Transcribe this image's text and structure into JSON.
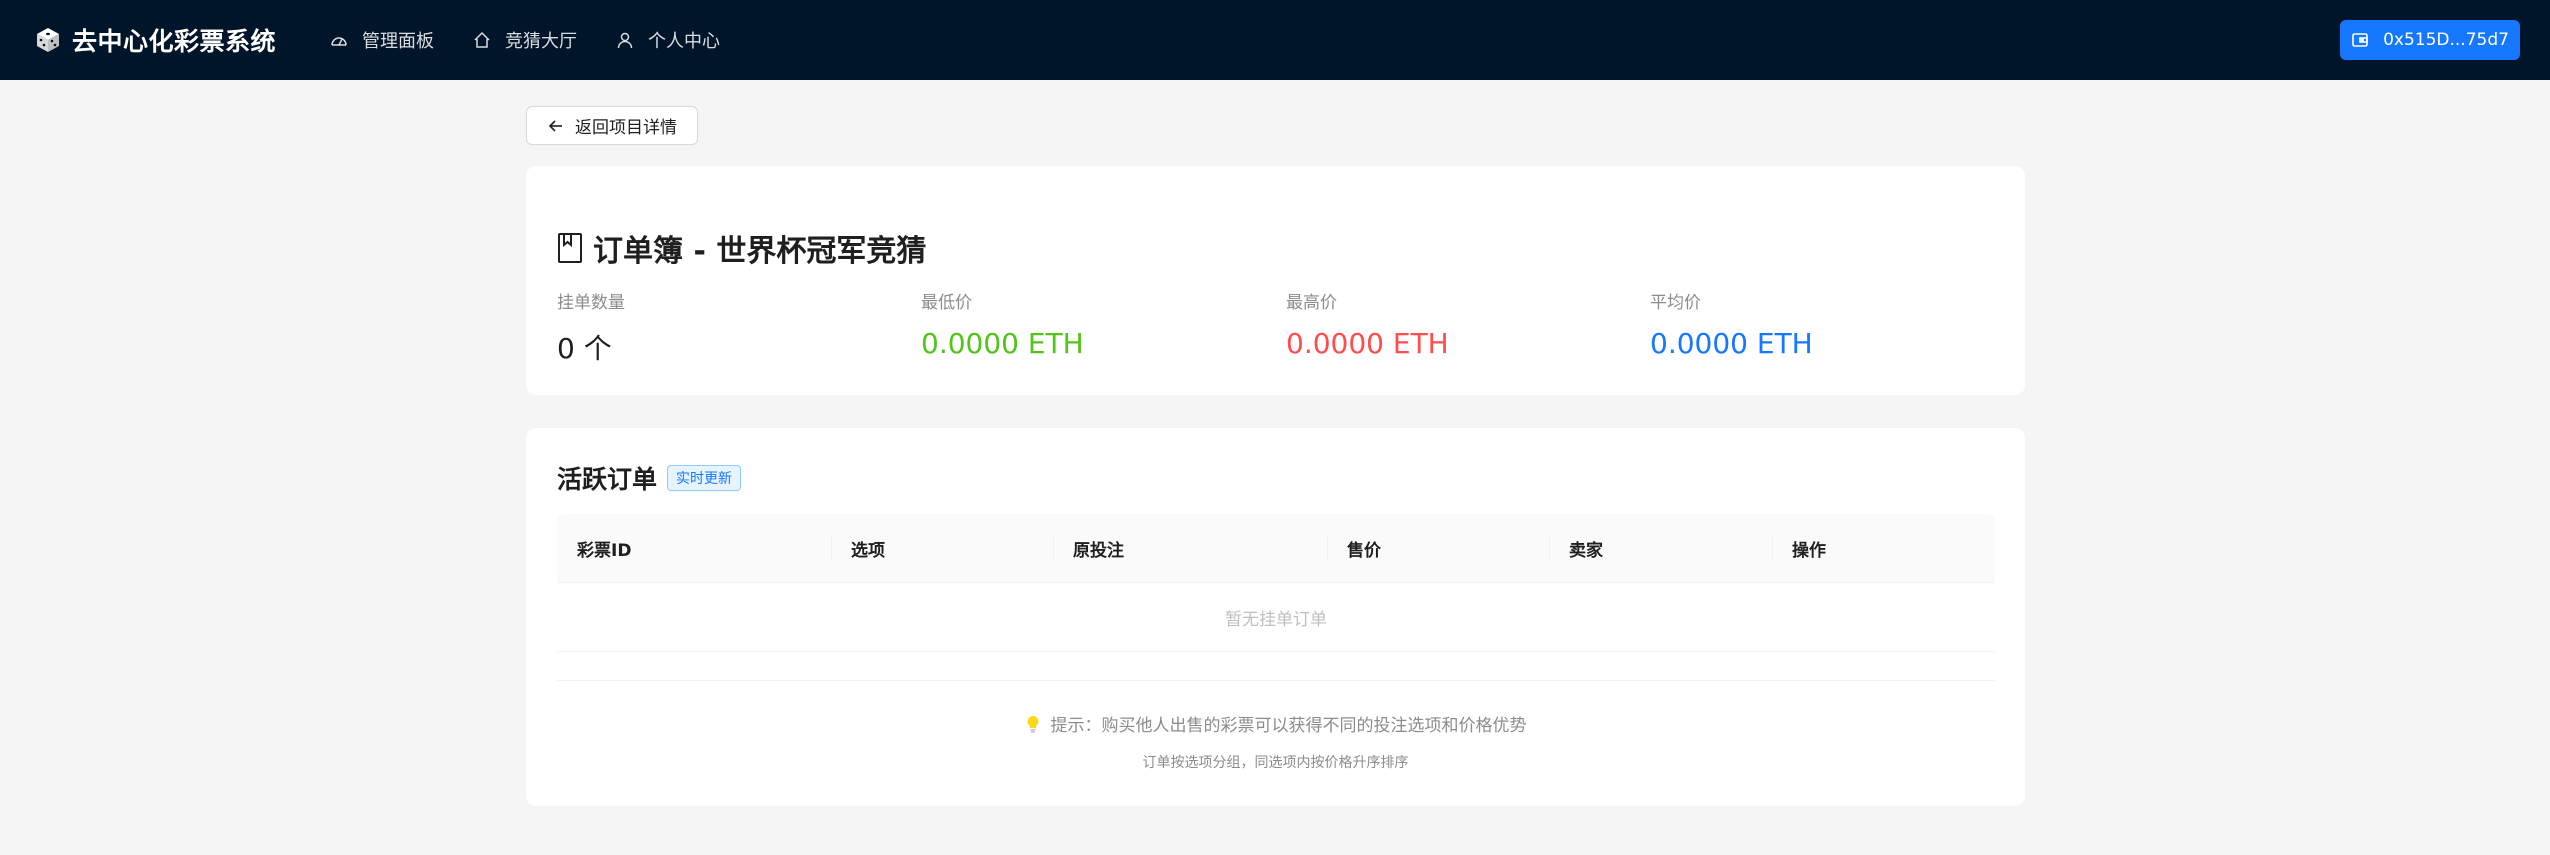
{
  "header": {
    "brand_title": "去中心化彩票系统",
    "nav": [
      {
        "label": "管理面板",
        "icon": "dashboard-icon"
      },
      {
        "label": "竞猜大厅",
        "icon": "home-icon"
      },
      {
        "label": "个人中心",
        "icon": "user-icon"
      }
    ],
    "wallet_label": "0x515D...75d7",
    "wallet_icon": "wallet-icon"
  },
  "back_button": {
    "label": "返回项目详情",
    "icon": "arrow-left-icon"
  },
  "orderbook": {
    "title": "订单簿 - 世界杯冠军竞猜",
    "icon": "book-icon",
    "stats": [
      {
        "label": "挂单数量",
        "value": "0 个",
        "color": "#1f1f1f"
      },
      {
        "label": "最低价",
        "value": "0.0000 ETH",
        "color": "#52c41a"
      },
      {
        "label": "最高价",
        "value": "0.0000 ETH",
        "color": "#ff4d4f"
      },
      {
        "label": "平均价",
        "value": "0.0000 ETH",
        "color": "#1677ff"
      }
    ]
  },
  "active_orders": {
    "title": "活跃订单",
    "tag": "实时更新",
    "columns": [
      "彩票ID",
      "选项",
      "原投注",
      "售价",
      "卖家",
      "操作"
    ],
    "empty_text": "暂无挂单订单",
    "hint": "提示：购买他人出售的彩票可以获得不同的投注选项和价格优势",
    "hint_icon": "lightbulb-icon",
    "sub_hint": "订单按选项分组，同选项内按价格升序排序"
  },
  "colors": {
    "header_bg": "#001529",
    "accent": "#1677ff",
    "page_bg": "#f5f5f5"
  }
}
